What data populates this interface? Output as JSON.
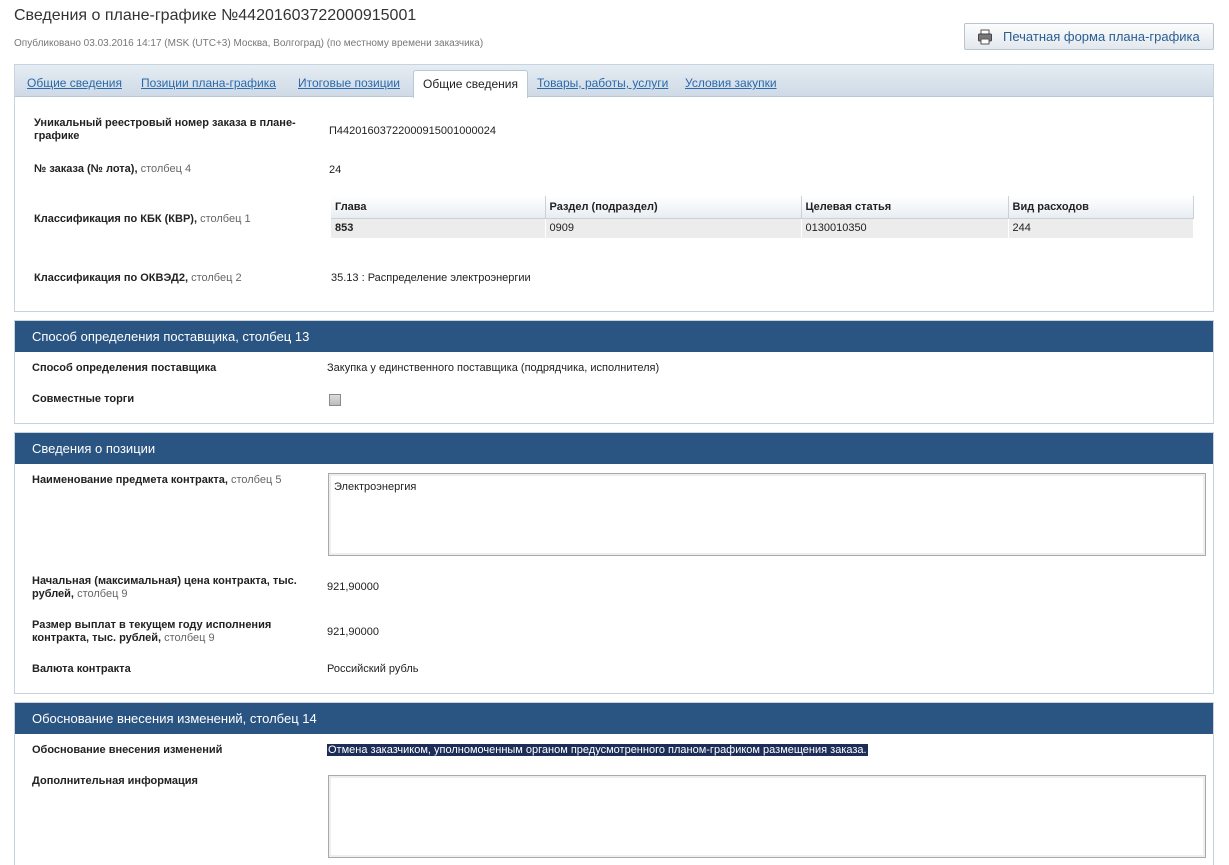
{
  "header": {
    "title": "Сведения о плане-графике №44201603722000915001",
    "published": "Опубликовано 03.03.2016 14:17 (MSK (UTC+3) Москва, Волгоград) (по местному времени заказчика)",
    "print_button": "Печатная форма плана-графика",
    "print_icon": "printer-icon"
  },
  "tabs": [
    {
      "label": "Общие сведения"
    },
    {
      "label": "Позиции плана-графика"
    },
    {
      "label": "Итоговые позиции"
    },
    {
      "label": "Общие сведения"
    },
    {
      "label": "Товары, работы, услуги"
    },
    {
      "label": "Условия закупки"
    }
  ],
  "general": {
    "reg_number_label": "Уникальный реестровый номер заказа в плане-графике",
    "reg_number_value": "П44201603722000915001000024",
    "order_no_label": "№ заказа (№ лота),",
    "order_no_col": "столбец 4",
    "order_no_value": "24",
    "kbk_label": "Классификация по КБК (КВР),",
    "kbk_col": "столбец 1",
    "kbk_headers": [
      "Глава",
      "Раздел (подраздел)",
      "Целевая статья",
      "Вид расходов"
    ],
    "kbk_row": [
      "853",
      "0909",
      "0130010350",
      "244"
    ],
    "okved_label": "Классификация по ОКВЭД2,",
    "okved_col": "столбец 2",
    "okved_value": "35.13 : Распределение электроэнергии"
  },
  "supplier": {
    "title": "Способ определения поставщика, столбец 13",
    "method_label": "Способ определения поставщика",
    "method_value": "Закупка у единственного поставщика (подрядчика, исполнителя)",
    "joint_label": "Совместные торги"
  },
  "position": {
    "title": "Сведения о позиции",
    "subject_label": "Наименование предмета контракта,",
    "subject_col": "столбец 5",
    "subject_value": "Электроэнергия",
    "price_label_1": "Начальная (максимальная) цена контракта, тыс.",
    "price_label_2": "рублей,",
    "price_col": "столбец 9",
    "price_value": "921,90000",
    "payment_label_1": "Размер выплат в текущем году исполнения",
    "payment_label_2": "контракта, тыс. рублей,",
    "payment_col": "столбец 9",
    "payment_value": "921,90000",
    "currency_label": "Валюта контракта",
    "currency_value": "Российский рубль"
  },
  "changes": {
    "title": "Обоснование внесения изменений, столбец 14",
    "reason_label": "Обоснование внесения изменений",
    "reason_value": "Отмена заказчиком, уполномоченным органом предусмотренного планом-графиком размещения заказа.",
    "extra_label": "Дополнительная информация"
  }
}
